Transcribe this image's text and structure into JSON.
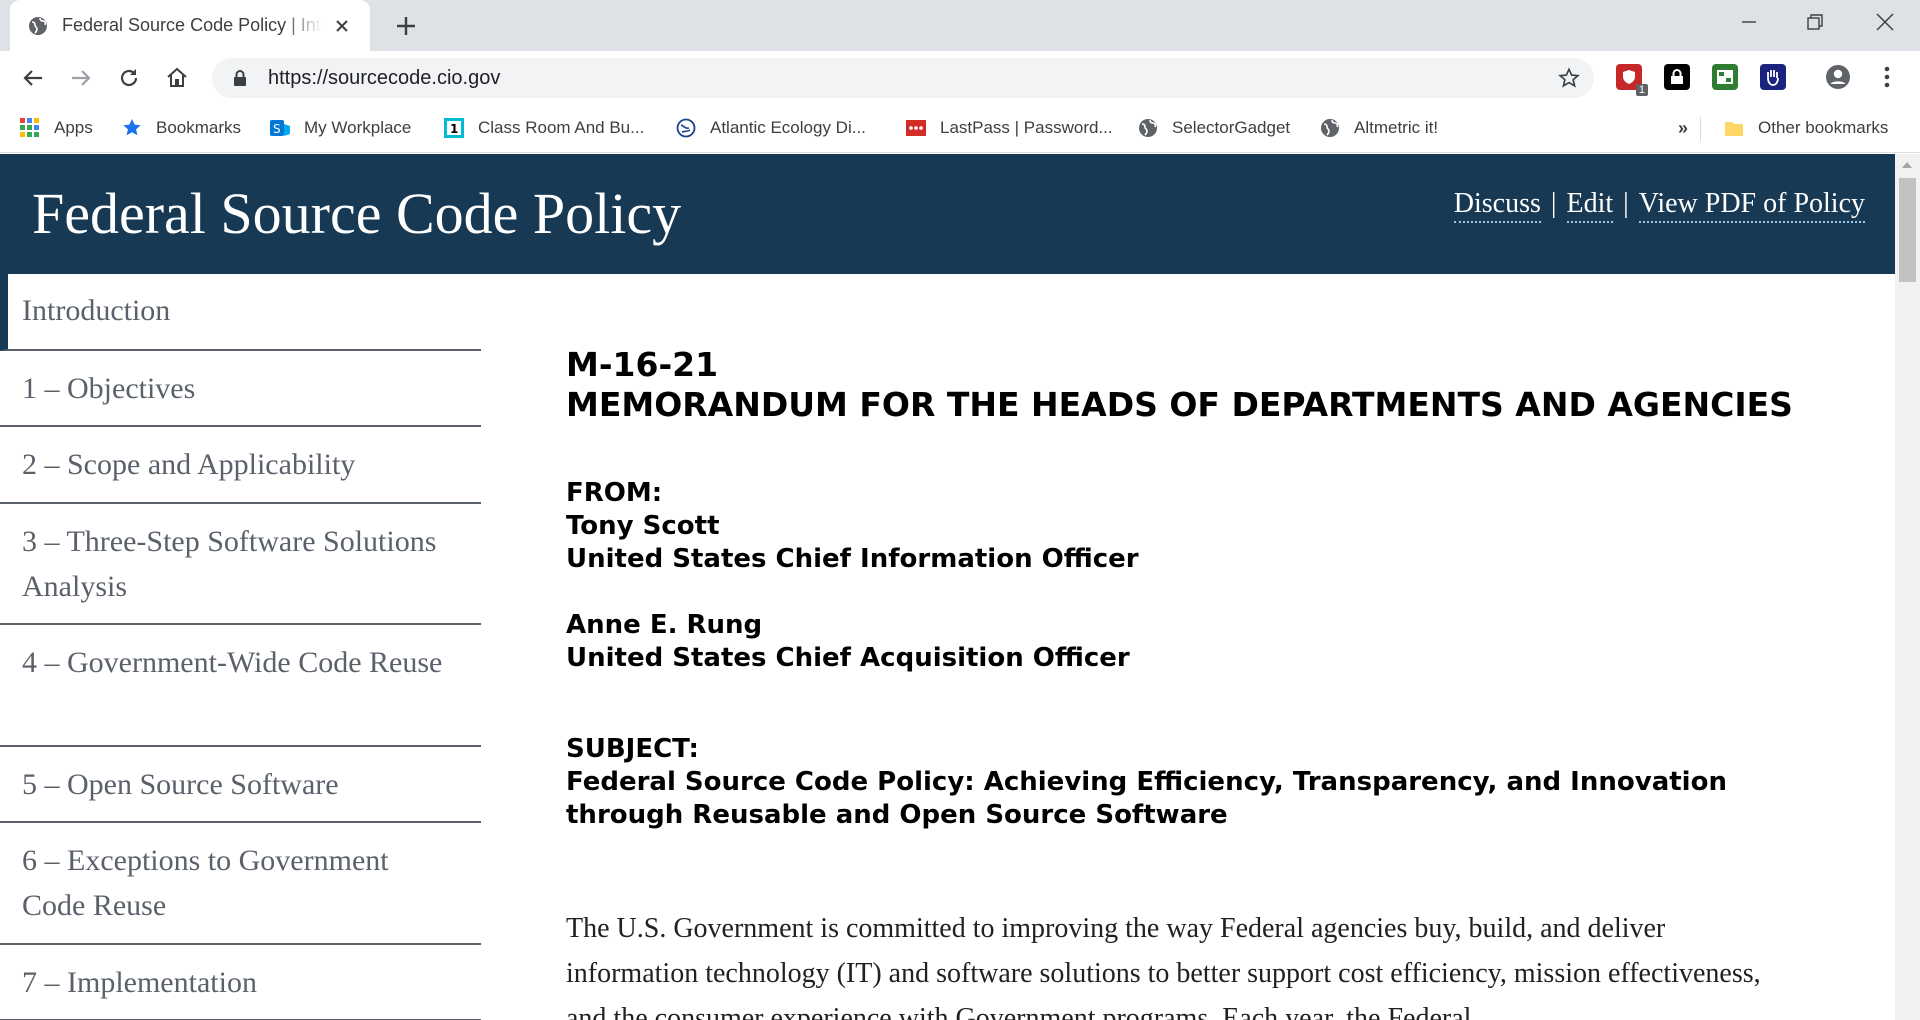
{
  "browser": {
    "tab_title": "Federal Source Code Policy | Introduction",
    "url": "https://sourcecode.cio.gov",
    "bookmarks": [
      {
        "label": "Apps",
        "icon": "apps-grid-icon"
      },
      {
        "label": "Bookmarks",
        "icon": "star-icon"
      },
      {
        "label": "My Workplace",
        "icon": "sharepoint-icon"
      },
      {
        "label": "Class Room And Bu...",
        "icon": "calendar-icon"
      },
      {
        "label": "Atlantic Ecology Di...",
        "icon": "globe-icon"
      },
      {
        "label": "LastPass | Password...",
        "icon": "lastpass-icon"
      },
      {
        "label": "SelectorGadget",
        "icon": "globe-icon"
      },
      {
        "label": "Altmetric it!",
        "icon": "globe-icon"
      }
    ],
    "overflow_label": "»",
    "other_bookmarks": "Other bookmarks",
    "extension_badge": "1"
  },
  "header": {
    "title": "Federal Source Code Policy",
    "links": [
      "Discuss",
      "Edit",
      "View PDF of Policy"
    ],
    "separator": "|"
  },
  "sidebar": {
    "items": [
      {
        "label": "Introduction"
      },
      {
        "label": "1 – Objectives"
      },
      {
        "label": "2 – Scope and Applicability"
      },
      {
        "label": "3 – Three-Step Software Solutions Analysis"
      },
      {
        "label": "4 – Government-Wide Code Reuse"
      },
      {
        "label": "5 – Open Source Software"
      },
      {
        "label": "6 – Exceptions to Government Code Reuse"
      },
      {
        "label": "7 – Implementation"
      }
    ]
  },
  "content": {
    "memo_number": "M-16-21",
    "memo_heading": "MEMORANDUM FOR THE HEADS OF DEPARTMENTS AND AGENCIES",
    "from_label": "FROM:",
    "from_name_1": "Tony Scott",
    "from_title_1": "United States Chief Information Officer",
    "from_name_2": "Anne E. Rung",
    "from_title_2": "United States Chief Acquisition Officer",
    "subject_label": "SUBJECT:",
    "subject_text": "Federal Source Code Policy: Achieving Efficiency, Transparency, and Innovation through Reusable and Open Source Software",
    "intro_paragraph": "The U.S. Government is committed to improving the way Federal agencies buy, build, and deliver information technology (IT) and software solutions to better support cost efficiency, mission effectiveness, and the consumer experience with Government programs. Each year, the Federal"
  },
  "colors": {
    "header_bg": "#173953",
    "sidebar_text": "#5b616b",
    "link_underline": "#9fc4e6"
  }
}
